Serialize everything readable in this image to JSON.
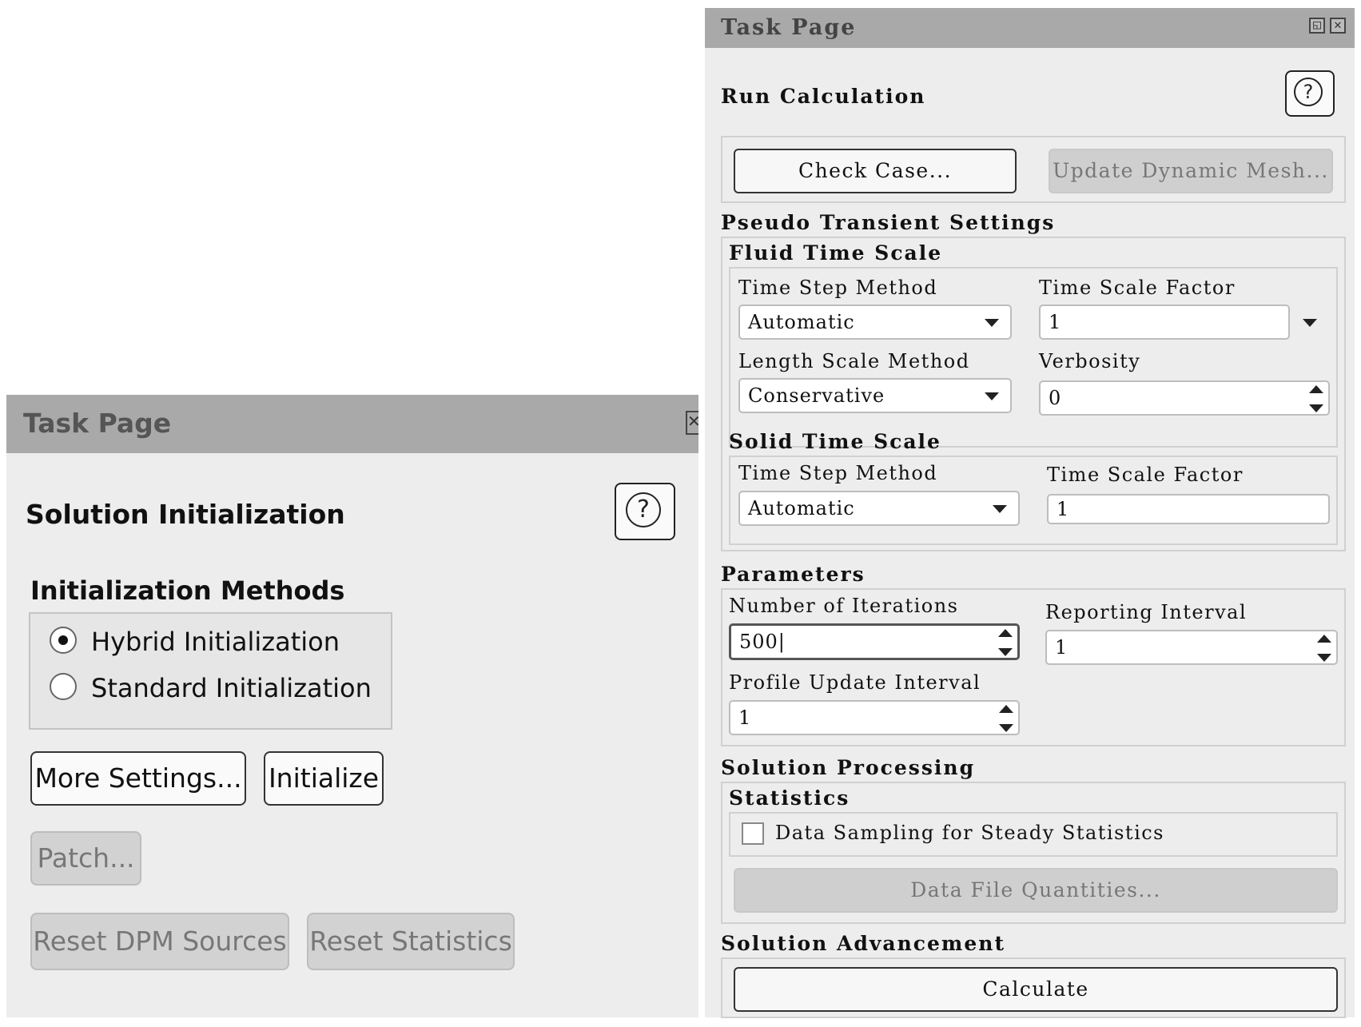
{
  "left_panel": {
    "title": "Task Page",
    "close_glyph": "✕",
    "section_title": "Solution Initialization",
    "help_glyph": "?",
    "methods_heading": "Initialization Methods",
    "methods": [
      {
        "label": "Hybrid  Initialization",
        "selected": true
      },
      {
        "label": "Standard Initialization",
        "selected": false
      }
    ],
    "buttons": {
      "more_settings": "More Settings...",
      "initialize": "Initialize",
      "patch": "Patch...",
      "reset_dpm": "Reset DPM Sources",
      "reset_statistics": "Reset Statistics"
    }
  },
  "right_panel": {
    "title": "Task Page",
    "section_title": "Run Calculation",
    "help_glyph": "?",
    "check_case": "Check Case...",
    "update_dynamic_mesh": "Update Dynamic Mesh...",
    "pseudo_heading": "Pseudo Transient Settings",
    "fluid": {
      "heading": "Fluid Time Scale",
      "time_step_method_label": "Time Step Method",
      "time_step_method_value": "Automatic",
      "time_scale_factor_label": "Time Scale Factor",
      "time_scale_factor_value": "1",
      "length_scale_method_label": "Length Scale Method",
      "length_scale_method_value": "Conservative",
      "verbosity_label": "Verbosity",
      "verbosity_value": "0"
    },
    "solid": {
      "heading": "Solid Time Scale",
      "time_step_method_label": "Time Step Method",
      "time_step_method_value": "Automatic",
      "time_scale_factor_label": "Time Scale Factor",
      "time_scale_factor_value": "1"
    },
    "parameters": {
      "heading": "Parameters",
      "iterations_label": "Number of Iterations",
      "iterations_value": "500|",
      "reporting_label": "Reporting Interval",
      "reporting_value": "1",
      "profile_label": "Profile Update Interval",
      "profile_value": "1"
    },
    "processing": {
      "heading": "Solution Processing",
      "statistics_heading": "Statistics",
      "data_sampling_label": "Data Sampling for Steady Statistics",
      "data_sampling_checked": false,
      "data_file_quantities": "Data File Quantities..."
    },
    "advancement": {
      "heading": "Solution Advancement",
      "calculate": "Calculate"
    }
  }
}
